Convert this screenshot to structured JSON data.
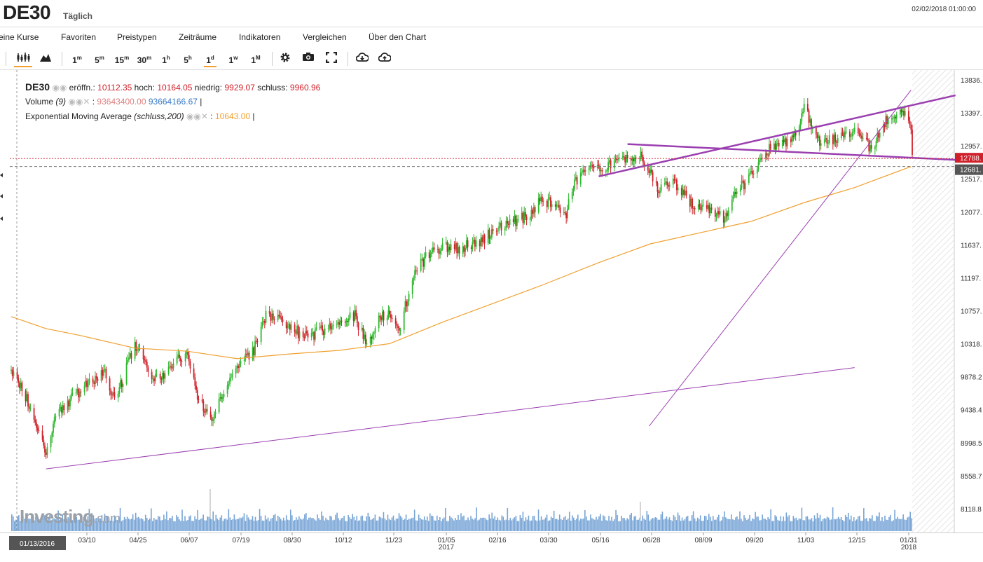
{
  "header": {
    "symbol": "DE30",
    "period": "Täglich",
    "datetime": "02/02/2018 01:00:00"
  },
  "menu": [
    "eine Kurse",
    "Favoriten",
    "Preistypen",
    "Zeiträume",
    "Indikatoren",
    "Vergleichen",
    "Über den Chart"
  ],
  "toolbar": {
    "intervals": [
      {
        "n": "1",
        "u": "m"
      },
      {
        "n": "5",
        "u": "m"
      },
      {
        "n": "15",
        "u": "m"
      },
      {
        "n": "30",
        "u": "m"
      },
      {
        "n": "1",
        "u": "h"
      },
      {
        "n": "5",
        "u": "h"
      },
      {
        "n": "1",
        "u": "d"
      },
      {
        "n": "1",
        "u": "w"
      },
      {
        "n": "1",
        "u": "M"
      }
    ],
    "active_interval": 6
  },
  "legend": {
    "symbol": "DE30",
    "open_label": "eröffn.:",
    "open": "10112.35",
    "high_label": "hoch:",
    "high": "10164.05",
    "low_label": "niedrig:",
    "low": "9929.07",
    "close_label": "schluss:",
    "close": "9960.96",
    "volume_label": "Volume",
    "volume_param": "(9)",
    "volume_value1": "93643400.00",
    "volume_value2": "93664166.67",
    "ema_label": "Exponential Moving Average",
    "ema_param": "(schluss,200)",
    "ema_value": "10643.00"
  },
  "colors": {
    "up": "#2db82d",
    "down": "#d0202a",
    "ema": "#f0a030",
    "trend": "#9b3fb0",
    "volume": "#4a86c8"
  },
  "logo": {
    "name": "Investing",
    "suffix": ".com"
  },
  "chart_data": {
    "type": "candlestick",
    "y_ticks": [
      "13836.",
      "13397.",
      "12957.",
      "12517.",
      "12077.",
      "11637.",
      "11197.",
      "10757.",
      "10318.",
      "9878.2",
      "9438.4",
      "8998.5",
      "8558.7",
      "8118.8"
    ],
    "y_tick_values": [
      13836,
      13397,
      12957,
      12517,
      12077,
      11637,
      11197,
      10757,
      10318,
      9878.2,
      9438.4,
      8998.5,
      8558.7,
      8118.8
    ],
    "ylim": [
      8118.8,
      13836
    ],
    "x_ticks": [
      "01/13/2016",
      "03/10",
      "04/25",
      "06/07",
      "07/19",
      "08/30",
      "10/12",
      "11/23",
      "01/05",
      "02/16",
      "03/30",
      "05/16",
      "06/28",
      "08/09",
      "09/20",
      "11/03",
      "12/15",
      "01/31"
    ],
    "x_year_labels": [
      {
        "at": "01/05",
        "year": "2017"
      },
      {
        "at": "01/31",
        "year": "2018"
      }
    ],
    "current_price_label": "12788.",
    "reference_price_label": "12681.",
    "close_path": [
      [
        "01/13/2016",
        9960
      ],
      [
        "01/22/2016",
        9750
      ],
      [
        "02/11/2016",
        8850
      ],
      [
        "02/18/2016",
        9350
      ],
      [
        "03/10",
        9700
      ],
      [
        "03/31",
        9950
      ],
      [
        "04/08",
        9550
      ],
      [
        "04/25",
        10300
      ],
      [
        "05/03",
        10100
      ],
      [
        "05/10",
        9850
      ],
      [
        "05/24",
        9950
      ],
      [
        "06/07",
        10250
      ],
      [
        "06/16",
        9600
      ],
      [
        "06/27",
        9300
      ],
      [
        "07/08",
        9650
      ],
      [
        "07/19",
        10050
      ],
      [
        "08/01",
        10200
      ],
      [
        "08/12",
        10700
      ],
      [
        "08/30",
        10600
      ],
      [
        "09/13",
        10400
      ],
      [
        "09/28",
        10500
      ],
      [
        "10/12",
        10600
      ],
      [
        "10/25",
        10700
      ],
      [
        "11/04",
        10300
      ],
      [
        "11/14",
        10700
      ],
      [
        "11/23",
        10700
      ],
      [
        "12/02",
        10550
      ],
      [
        "12/12",
        11200
      ],
      [
        "12/22",
        11450
      ],
      [
        "01/05",
        11600
      ],
      [
        "01/20",
        11600
      ],
      [
        "02/02",
        11650
      ],
      [
        "02/16",
        11800
      ],
      [
        "03/03",
        11950
      ],
      [
        "03/16",
        12000
      ],
      [
        "03/30",
        12250
      ],
      [
        "04/11",
        12150
      ],
      [
        "04/18",
        12000
      ],
      [
        "04/26",
        12450
      ],
      [
        "05/08",
        12700
      ],
      [
        "05/16",
        12650
      ],
      [
        "05/30",
        12750
      ],
      [
        "06/09",
        12800
      ],
      [
        "06/20",
        12850
      ],
      [
        "06/28",
        12600
      ],
      [
        "07/06",
        12350
      ],
      [
        "07/17",
        12500
      ],
      [
        "07/26",
        12300
      ],
      [
        "08/09",
        12100
      ],
      [
        "08/18",
        12100
      ],
      [
        "08/29",
        12000
      ],
      [
        "09/08",
        12350
      ],
      [
        "09/20",
        12550
      ],
      [
        "10/04",
        12900
      ],
      [
        "10/18",
        13000
      ],
      [
        "10/26",
        13100
      ],
      [
        "11/03",
        13450
      ],
      [
        "11/08",
        13300
      ],
      [
        "11/17",
        13000
      ],
      [
        "11/28",
        13050
      ],
      [
        "12/07",
        13100
      ],
      [
        "12/15",
        13150
      ],
      [
        "12/29",
        12900
      ],
      [
        "01/10",
        13300
      ],
      [
        "01/23",
        13450
      ],
      [
        "01/26",
        13350
      ],
      [
        "01/31",
        13200
      ],
      [
        "02/01",
        12788
      ]
    ],
    "ema200": [
      [
        "01/13/2016",
        10680
      ],
      [
        "02/11/2016",
        10520
      ],
      [
        "03/10",
        10430
      ],
      [
        "04/25",
        10260
      ],
      [
        "06/07",
        10220
      ],
      [
        "07/19",
        10120
      ],
      [
        "08/30",
        10180
      ],
      [
        "10/12",
        10230
      ],
      [
        "11/23",
        10320
      ],
      [
        "01/05",
        10600
      ],
      [
        "02/16",
        10850
      ],
      [
        "03/30",
        11100
      ],
      [
        "05/16",
        11400
      ],
      [
        "06/28",
        11650
      ],
      [
        "08/09",
        11800
      ],
      [
        "09/20",
        11950
      ],
      [
        "11/03",
        12200
      ],
      [
        "12/15",
        12400
      ],
      [
        "01/31",
        12681
      ]
    ],
    "trendlines": [
      {
        "from": [
          "02/11/2016",
          8650
        ],
        "to": [
          "12/15",
          10000
        ]
      },
      {
        "from": [
          "06/27",
          9220
        ],
        "to": [
          "01/31",
          13700
        ]
      },
      {
        "from": [
          "05/16",
          12550
        ],
        "to": [
          "02/02/2018",
          13630
        ]
      },
      {
        "from": [
          "06/09",
          12980
        ],
        "to": [
          "02/02/2018",
          12770
        ]
      }
    ]
  }
}
